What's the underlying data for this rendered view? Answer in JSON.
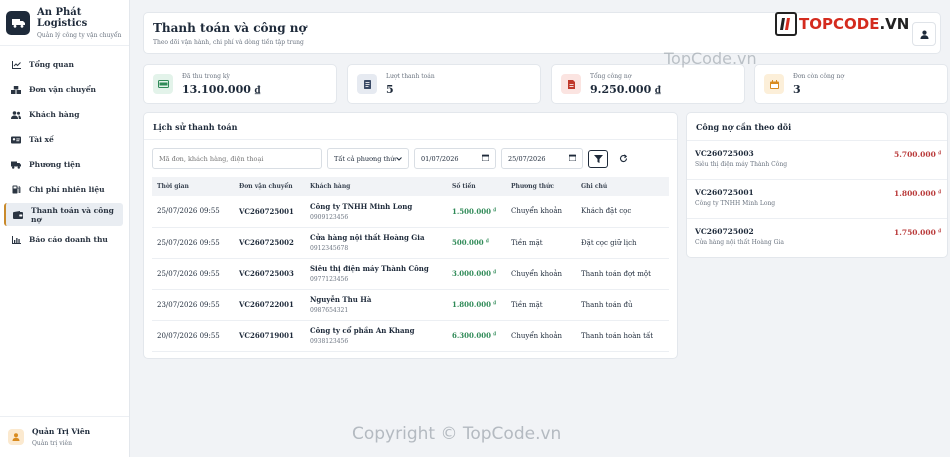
{
  "brand": {
    "title": "An Phát Logistics",
    "subtitle": "Quản lý công ty vận chuyển"
  },
  "sidebar": {
    "items": [
      {
        "label": "Tổng quan",
        "icon": "chart-line-icon"
      },
      {
        "label": "Đơn vận chuyển",
        "icon": "boxes-icon"
      },
      {
        "label": "Khách hàng",
        "icon": "users-icon"
      },
      {
        "label": "Tài xế",
        "icon": "id-card-icon"
      },
      {
        "label": "Phương tiện",
        "icon": "truck-icon"
      },
      {
        "label": "Chi phí nhiên liệu",
        "icon": "fuel-icon"
      },
      {
        "label": "Thanh toán và công nợ",
        "icon": "wallet-icon",
        "active": true
      },
      {
        "label": "Báo cáo doanh thu",
        "icon": "bar-chart-icon"
      }
    ],
    "user": {
      "name": "Quản Trị Viên",
      "role": "Quản trị viên"
    }
  },
  "header": {
    "title": "Thanh toán và công nợ",
    "subtitle": "Theo dõi vận hành, chi phí và dòng tiền tập trung"
  },
  "stats": [
    {
      "label": "Đã thu trong kỳ",
      "value": "13.100.000 ₫",
      "icon": "money-icon",
      "color": "#2f8a57",
      "bg": "#e3f3ea"
    },
    {
      "label": "Lượt thanh toán",
      "value": "5",
      "icon": "receipt-icon",
      "color": "#3a4a66",
      "bg": "#e6eaf1"
    },
    {
      "label": "Tổng công nợ",
      "value": "9.250.000 ₫",
      "icon": "invoice-icon",
      "color": "#c0392b",
      "bg": "#fbe4e1"
    },
    {
      "label": "Đơn còn công nợ",
      "value": "3",
      "icon": "calendar-icon",
      "color": "#d98b1f",
      "bg": "#fcefd9"
    }
  ],
  "history": {
    "title": "Lịch sử thanh toán",
    "search_placeholder": "Mã đơn, khách hàng, điện thoại",
    "method_select": "Tất cả phương thức",
    "date_from": "01/07/2026",
    "date_to": "25/07/2026",
    "columns": [
      "Thời gian",
      "Đơn vận chuyển",
      "Khách hàng",
      "Số tiền",
      "Phương thức",
      "Ghi chú"
    ],
    "rows": [
      {
        "time": "25/07/2026 09:55",
        "order": "VC260725001",
        "customer": "Công ty TNHH Minh Long",
        "phone": "0909123456",
        "amount": "1.500.000",
        "currency": "₫",
        "method": "Chuyển khoản",
        "note": "Khách đặt cọc"
      },
      {
        "time": "25/07/2026 09:55",
        "order": "VC260725002",
        "customer": "Cửa hàng nội thất Hoàng Gia",
        "phone": "0912345678",
        "amount": "500.000",
        "currency": "₫",
        "method": "Tiền mặt",
        "note": "Đặt cọc giữ lịch"
      },
      {
        "time": "25/07/2026 09:55",
        "order": "VC260725003",
        "customer": "Siêu thị điện máy Thành Công",
        "phone": "0977123456",
        "amount": "3.000.000",
        "currency": "₫",
        "method": "Chuyển khoản",
        "note": "Thanh toán đợt một"
      },
      {
        "time": "23/07/2026 09:55",
        "order": "VC260722001",
        "customer": "Nguyễn Thu Hà",
        "phone": "0987654321",
        "amount": "1.800.000",
        "currency": "₫",
        "method": "Tiền mặt",
        "note": "Thanh toán đủ"
      },
      {
        "time": "20/07/2026 09:55",
        "order": "VC260719001",
        "customer": "Công ty cổ phần An Khang",
        "phone": "0938123456",
        "amount": "6.300.000",
        "currency": "₫",
        "method": "Chuyển khoản",
        "note": "Thanh toán hoàn tất"
      }
    ]
  },
  "debts": {
    "title": "Công nợ cần theo dõi",
    "items": [
      {
        "code": "VC260725003",
        "customer": "Siêu thị điện máy Thành Công",
        "amount": "5.700.000",
        "currency": "₫"
      },
      {
        "code": "VC260725001",
        "customer": "Công ty TNHH Minh Long",
        "amount": "1.800.000",
        "currency": "₫"
      },
      {
        "code": "VC260725002",
        "customer": "Cửa hàng nội thất Hoàng Gia",
        "amount": "1.750.000",
        "currency": "₫"
      }
    ]
  },
  "watermarks": {
    "logo_text_a": "TOPCODE",
    "logo_text_b": ".VN",
    "center": "TopCode.vn",
    "bottom": "Copyright © TopCode.vn"
  }
}
